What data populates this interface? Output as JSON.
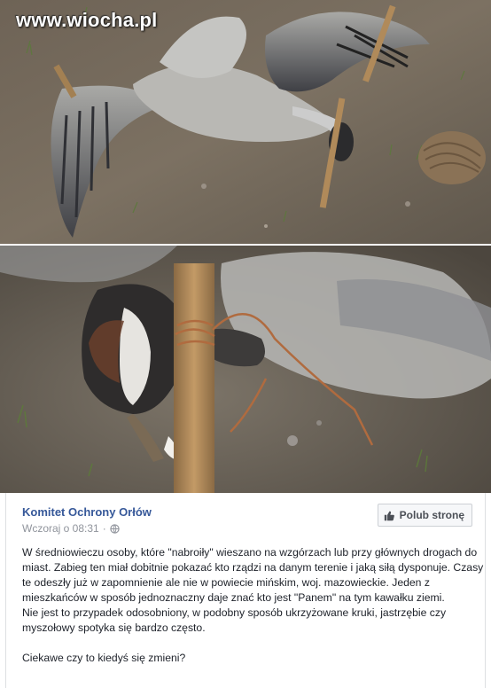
{
  "watermark": "www.wiocha.pl",
  "post": {
    "page_name": "Komitet Ochrony Orłów",
    "timestamp": "Wczoraj o 08:31",
    "separator": "·",
    "like_button_label": "Polub stronę",
    "paragraphs": [
      "W średniowieczu osoby, które \"nabroiły\" wieszano na wzgórzach lub przy głównych drogach do miast. Zabieg ten miał dobitnie pokazać kto rządzi na danym terenie i jaką siłą dysponuje. Czasy te odeszły już w zapomnienie ale nie w powiecie mińskim, woj. mazowieckie. Jeden z mieszkańców w sposób jednoznaczny daje znać kto jest \"Panem\" na tym kawałku ziemi.",
      "Nie jest to przypadek odosobniony, w podobny sposób ukrzyżowane kruki, jastrzębie czy myszołowy spotyka się bardzo często.",
      "Ciekawe czy to kiedyś się zmieni?"
    ]
  },
  "icons": {
    "globe": "globe-icon",
    "like": "thumbs-up-icon"
  },
  "colors": {
    "link": "#365899",
    "meta": "#90949c",
    "text": "#1d2129"
  }
}
